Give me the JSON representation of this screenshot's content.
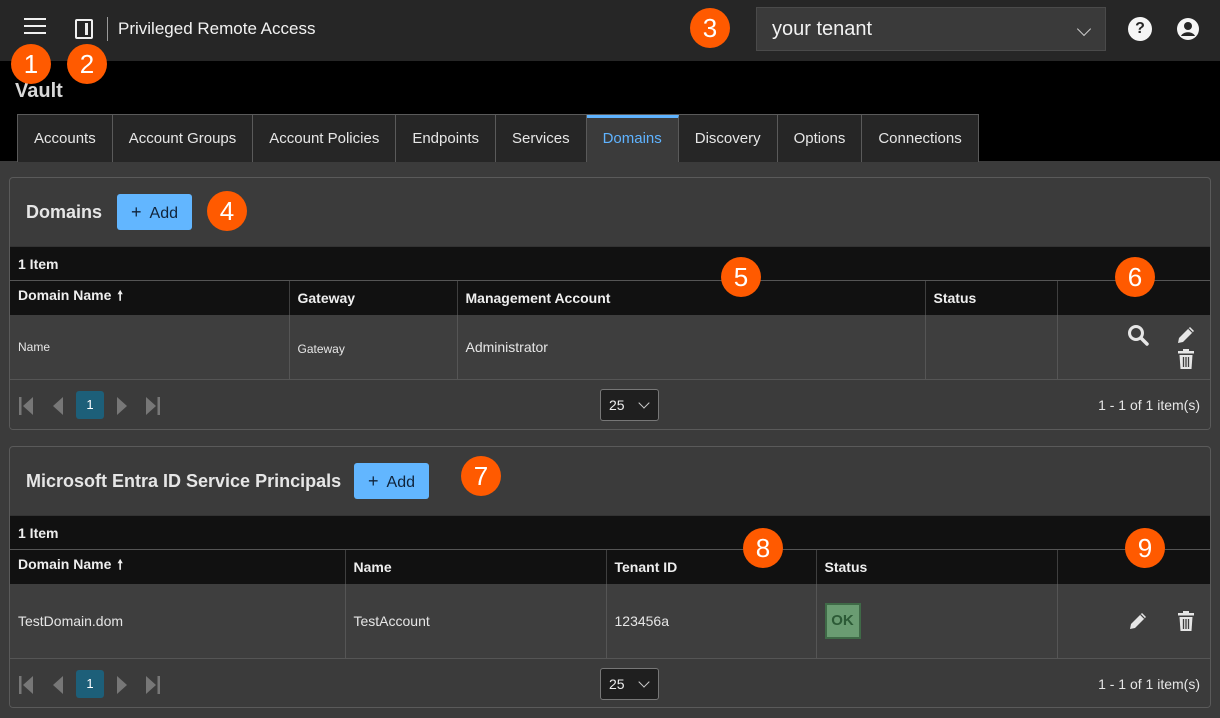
{
  "header": {
    "app_title": "Privileged Remote Access",
    "tenant_value": "your tenant",
    "help_glyph": "?",
    "icons": [
      "hamburger-menu-icon",
      "side-panel-icon",
      "help-icon",
      "user-account-icon"
    ]
  },
  "callouts": [
    "1",
    "2",
    "3",
    "4",
    "5",
    "6",
    "7",
    "8",
    "9"
  ],
  "vault": {
    "title": "Vault",
    "tabs": [
      "Accounts",
      "Account Groups",
      "Account Policies",
      "Endpoints",
      "Services",
      "Domains",
      "Discovery",
      "Options",
      "Connections"
    ],
    "active_tab": "Domains"
  },
  "domains_panel": {
    "title": "Domains",
    "add_label": "Add",
    "count_label": "1 Item",
    "columns": [
      "Domain Name",
      "Gateway",
      "Management Account",
      "Status",
      ""
    ],
    "sort_glyph": "🠕",
    "rows": [
      {
        "domain_name": "Name",
        "gateway": "Gateway",
        "management_account": "Administrator",
        "status": ""
      }
    ],
    "row_actions": [
      "search-icon",
      "edit-icon",
      "delete-icon"
    ],
    "pager": {
      "current_page": "1",
      "page_size": "25",
      "range_text": "1 - 1 of 1 item(s)"
    }
  },
  "entra_panel": {
    "title": "Microsoft Entra ID Service Principals",
    "add_label": "Add",
    "count_label": "1 Item",
    "columns": [
      "Domain Name",
      "Name",
      "Tenant ID",
      "Status",
      ""
    ],
    "sort_glyph": "🠕",
    "rows": [
      {
        "domain_name": "TestDomain.dom",
        "name": "TestAccount",
        "tenant_id": "123456a",
        "status": "OK"
      }
    ],
    "row_actions": [
      "edit-icon",
      "delete-icon"
    ],
    "pager": {
      "current_page": "1",
      "page_size": "25",
      "range_text": "1 - 1 of 1 item(s)"
    }
  },
  "colors": {
    "callout": "#ff5a00",
    "accent": "#5fb3ff",
    "add_button": "#62b6ff",
    "status_ok": "#6a9c72"
  }
}
